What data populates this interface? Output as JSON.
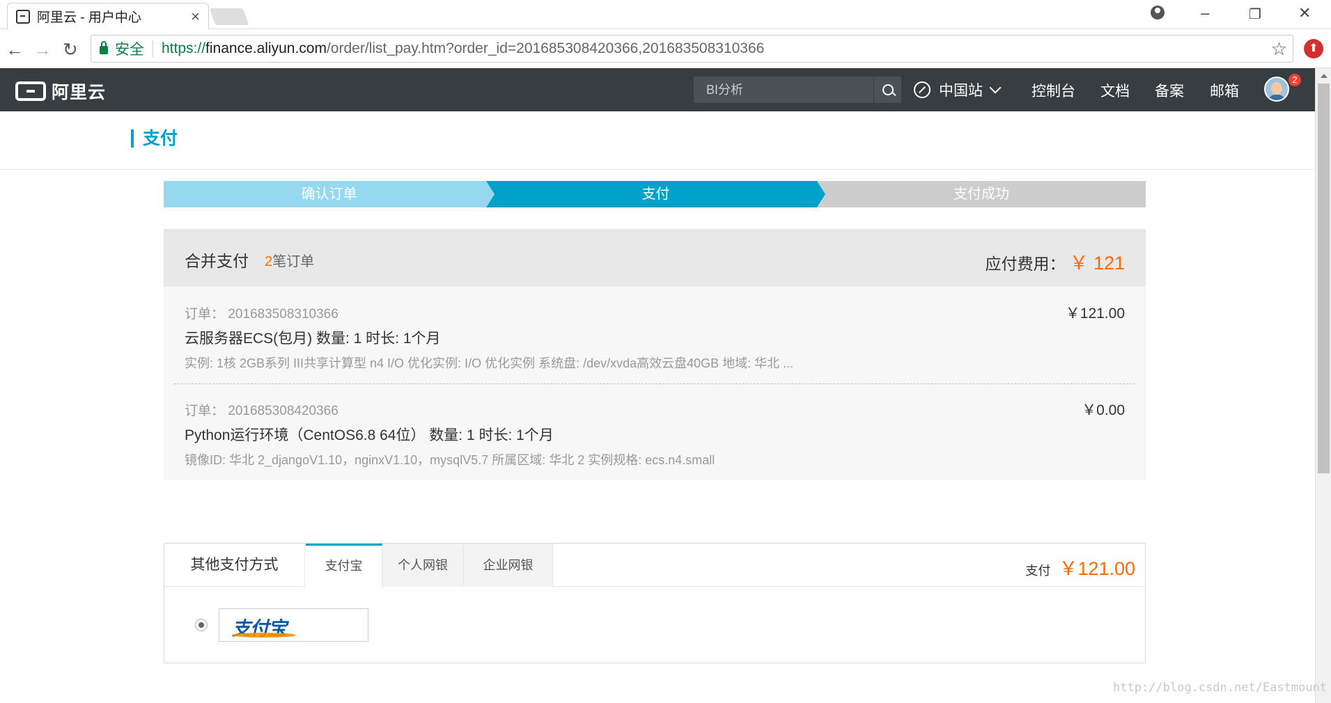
{
  "browser": {
    "tab_title": "阿里云 - 用户中心",
    "tab_close": "×",
    "secure_label": "安全",
    "url_scheme": "https://",
    "url_host": "finance.aliyun.com",
    "url_path": "/order/list_pay.htm?order_id=201685308420366,201683508310366",
    "window_controls": [
      "minimize-icon",
      "restore-icon",
      "close-icon"
    ]
  },
  "topnav": {
    "logo_text": "阿里云",
    "search_placeholder": "BI分析",
    "region": "中国站",
    "links": [
      "控制台",
      "文档",
      "备案",
      "邮箱"
    ],
    "badge_count": "2"
  },
  "page": {
    "title": "支付",
    "steps": [
      "确认订单",
      "支付",
      "支付成功"
    ],
    "active_step": "支付"
  },
  "summary": {
    "title": "合并支付",
    "count": "2",
    "count_suffix": "笔订单",
    "due_label": "应付费用：",
    "due_amount": "￥ 121"
  },
  "orders": [
    {
      "id_label": "订单： 201683508310366",
      "price": "￥121.00",
      "name": "云服务器ECS(包月)  数量: 1  时长: 1个月",
      "spec": "实例: 1核 2GB系列 III共享计算型 n4 I/O 优化实例: I/O 优化实例 系统盘: /dev/xvda高效云盘40GB 地域: 华北 ..."
    },
    {
      "id_label": "订单： 201685308420366",
      "price": "￥0.00",
      "name": "Python运行环境（CentOS6.8 64位）  数量: 1  时长: 1个月",
      "spec": "镜像ID: 华北 2_djangoV1.10，nginxV1.10，mysqlV5.7 所属区域: 华北 2 实例规格: ecs.n4.small"
    }
  ],
  "payment": {
    "section_label": "其他支付方式",
    "tabs": [
      "支付宝",
      "个人网银",
      "企业网银"
    ],
    "active_tab": "支付宝",
    "total_label": "支付",
    "total_amount": "￥121.00",
    "method_logo": "支付宝"
  },
  "watermark": "http://blog.csdn.net/Eastmount",
  "colors": {
    "accent": "#00a2ca",
    "price": "#ff6a00",
    "topnav_bg": "#373d41",
    "step_done": "#96d8ef",
    "step_pending": "#cdcdcd"
  }
}
